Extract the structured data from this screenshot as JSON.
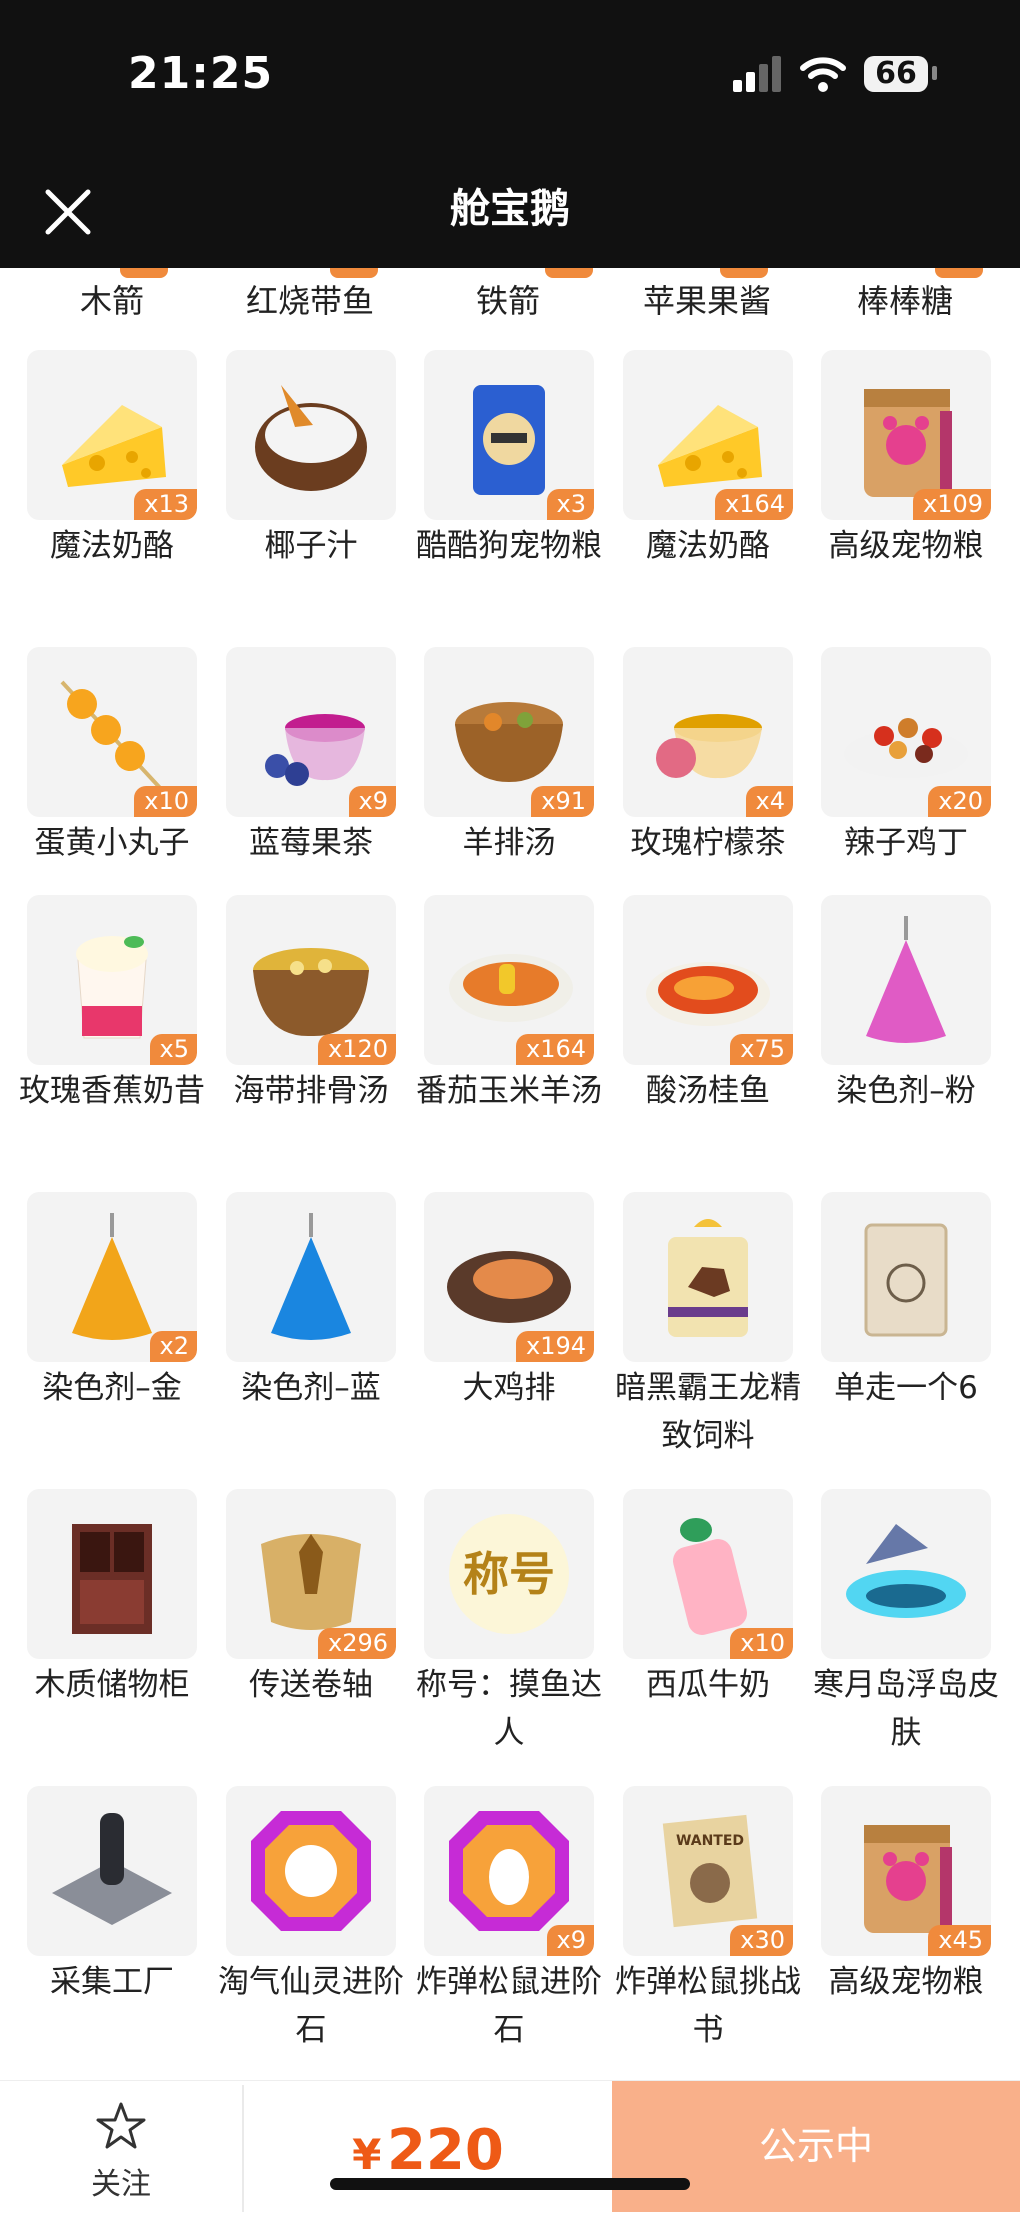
{
  "status_bar": {
    "time": "21:25",
    "battery": "66"
  },
  "nav": {
    "title": "舱宝鹅"
  },
  "partial_row": [
    "木箭",
    "红烧带鱼",
    "铁箭",
    "苹果果酱",
    "棒棒糖"
  ],
  "items": [
    {
      "name": "魔法奶酪",
      "qty": "x13",
      "icon": "cheese-icon"
    },
    {
      "name": "椰子汁",
      "qty": "",
      "icon": "coconut-icon"
    },
    {
      "name": "酷酷狗宠物粮",
      "qty": "x3",
      "icon": "dog-food-bag-icon"
    },
    {
      "name": "魔法奶酪",
      "qty": "x164",
      "icon": "cheese-icon"
    },
    {
      "name": "高级宠物粮",
      "qty": "x109",
      "icon": "pet-food-bag-icon"
    },
    {
      "name": "蛋黄小丸子",
      "qty": "x10",
      "icon": "skewer-balls-icon"
    },
    {
      "name": "蓝莓果茶",
      "qty": "x9",
      "icon": "blueberry-tea-icon"
    },
    {
      "name": "羊排汤",
      "qty": "x91",
      "icon": "soup-bowl-icon"
    },
    {
      "name": "玫瑰柠檬茶",
      "qty": "x4",
      "icon": "rose-tea-icon"
    },
    {
      "name": "辣子鸡丁",
      "qty": "x20",
      "icon": "spicy-chicken-icon"
    },
    {
      "name": "玫瑰香蕉奶昔",
      "qty": "x5",
      "icon": "milkshake-icon"
    },
    {
      "name": "海带排骨汤",
      "qty": "x120",
      "icon": "stew-pot-icon"
    },
    {
      "name": "番茄玉米羊汤",
      "qty": "x164",
      "icon": "tomato-soup-icon"
    },
    {
      "name": "酸汤桂鱼",
      "qty": "x75",
      "icon": "fish-soup-icon"
    },
    {
      "name": "染色剂–粉",
      "qty": "",
      "icon": "dye-pink-icon"
    },
    {
      "name": "染色剂–金",
      "qty": "x2",
      "icon": "dye-gold-icon"
    },
    {
      "name": "染色剂–蓝",
      "qty": "",
      "icon": "dye-blue-icon"
    },
    {
      "name": "大鸡排",
      "qty": "x194",
      "icon": "chicken-cutlet-icon"
    },
    {
      "name": "暗黑霸王龙精致饲料",
      "qty": "",
      "icon": "dino-food-bag-icon"
    },
    {
      "name": "单走一个6",
      "qty": "",
      "icon": "card-six-icon"
    },
    {
      "name": "木质储物柜",
      "qty": "",
      "icon": "wooden-cabinet-icon"
    },
    {
      "name": "传送卷轴",
      "qty": "x296",
      "icon": "scroll-icon"
    },
    {
      "name": "称号：摸鱼达人",
      "qty": "",
      "icon": "title-badge-icon",
      "badge_text": "称号"
    },
    {
      "name": "西瓜牛奶",
      "qty": "x10",
      "icon": "milk-bottle-icon"
    },
    {
      "name": "寒月岛浮岛皮肤",
      "qty": "",
      "icon": "floating-island-icon"
    },
    {
      "name": "采集工厂",
      "qty": "",
      "icon": "factory-icon"
    },
    {
      "name": "淘气仙灵进阶石",
      "qty": "",
      "icon": "gem-fairy-icon"
    },
    {
      "name": "炸弹松鼠进阶石",
      "qty": "x9",
      "icon": "gem-squirrel-icon"
    },
    {
      "name": "炸弹松鼠挑战书",
      "qty": "x30",
      "icon": "wanted-poster-icon",
      "badge_text": "WANTED"
    },
    {
      "name": "高级宠物粮",
      "qty": "x45",
      "icon": "pet-food-bag-icon"
    }
  ],
  "bottom": {
    "follow_label": "关注",
    "currency": "¥",
    "price": "220",
    "status_button": "公示中"
  },
  "colors": {
    "accent": "#f08a3c",
    "price": "#ee5a16",
    "status_bg": "#f9b08a",
    "header_bg": "#111111"
  }
}
